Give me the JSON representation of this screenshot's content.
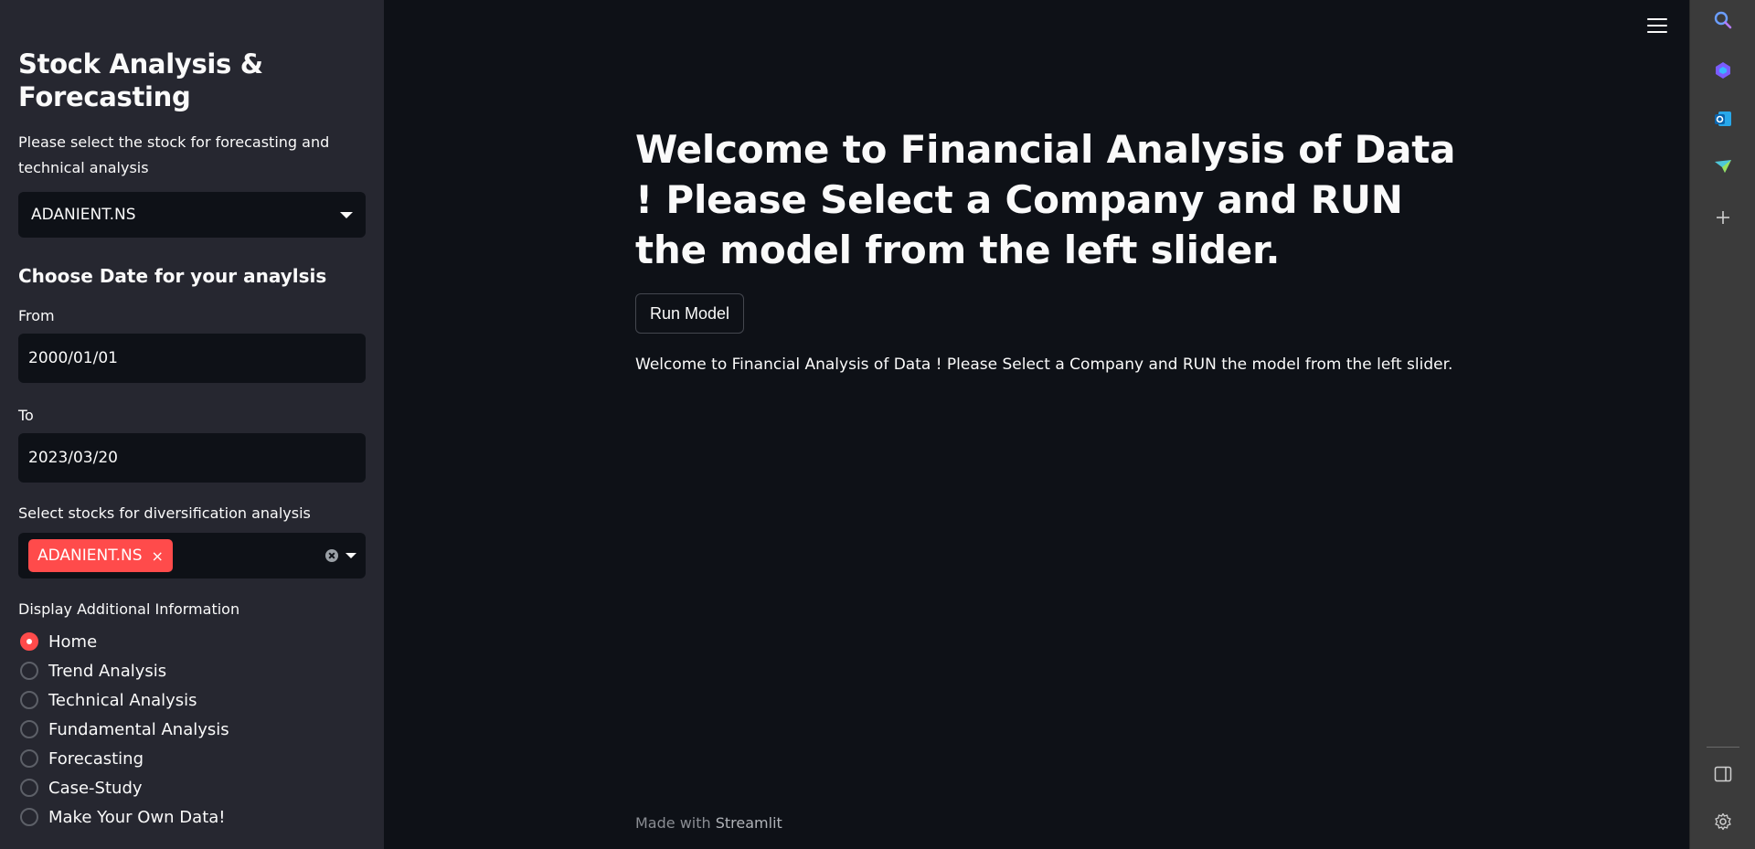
{
  "sidebar": {
    "title": "Stock Analysis & Forecasting",
    "stock_prompt": "Please select the stock for forecasting and technical analysis",
    "stock_selected": "ADANIENT.NS",
    "date_heading": "Choose Date for your anaylsis",
    "from_label": "From",
    "from_value": "2000/01/01",
    "to_label": "To",
    "to_value": "2023/03/20",
    "diversification_label": "Select stocks for diversification analysis",
    "diversification_tags": [
      "ADANIENT.NS"
    ],
    "tag_remove": "×",
    "additional_label": "Display Additional Information",
    "radio_options": [
      {
        "label": "Home",
        "checked": true
      },
      {
        "label": "Trend Analysis",
        "checked": false
      },
      {
        "label": "Technical Analysis",
        "checked": false
      },
      {
        "label": "Fundamental Analysis",
        "checked": false
      },
      {
        "label": "Forecasting",
        "checked": false
      },
      {
        "label": "Case-Study",
        "checked": false
      },
      {
        "label": "Make Your Own Data!",
        "checked": false
      }
    ]
  },
  "main": {
    "heading": "Welcome to Financial Analysis of Data ! Please Select a Company and RUN the model from the left slider.",
    "run_button": "Run Model",
    "paragraph": "Welcome to Financial Analysis of Data ! Please Select a Company and RUN the model from the left slider.",
    "footer_prefix": "Made with ",
    "footer_brand": "Streamlit"
  },
  "rail": {
    "icons": [
      "search-icon",
      "copilot-icon",
      "outlook-icon",
      "send-icon",
      "add-icon",
      "sidebar-toggle-icon",
      "settings-icon"
    ]
  },
  "colors": {
    "accent": "#ff4b4b",
    "background": "#0e1117",
    "sidebar": "#262730"
  }
}
